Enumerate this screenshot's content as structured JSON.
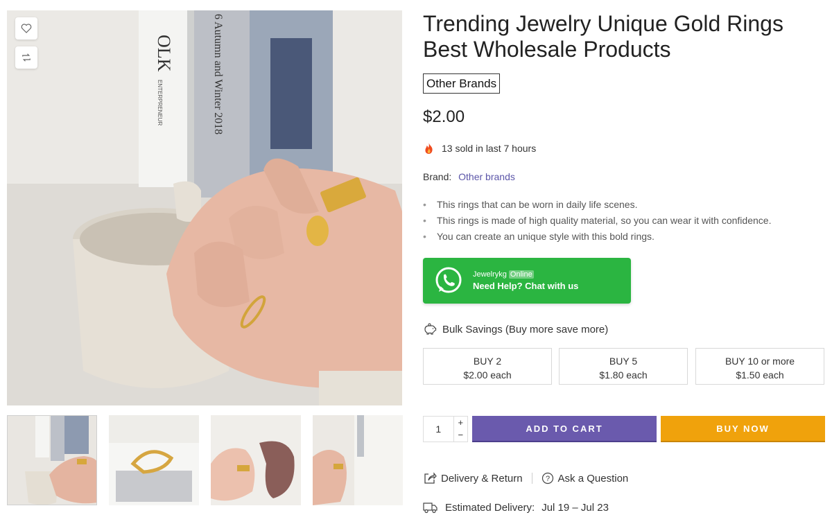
{
  "product": {
    "title": "Trending Jewelry Unique Gold Rings Best Wholesale Products",
    "brand_tag": "Other Brands",
    "price": "$2.00",
    "sold_text": "13 sold in last 7 hours",
    "brand_label": "Brand:",
    "brand_value": "Other brands",
    "features": [
      "This rings that can be worn in daily life scenes.",
      "This rings is made of high quality material, so you can wear it with confidence.",
      "You can create an unique style with this bold rings."
    ]
  },
  "chat": {
    "name": "Jewelrykg",
    "status": "Online",
    "cta": "Need Help? Chat with us"
  },
  "bulk": {
    "heading": "Bulk Savings (Buy more save more)",
    "tiers": [
      {
        "qty": "BUY 2",
        "price": "$2.00 each"
      },
      {
        "qty": "BUY 5",
        "price": "$1.80 each"
      },
      {
        "qty": "BUY 10 or more",
        "price": "$1.50 each"
      }
    ]
  },
  "cart": {
    "quantity": "1",
    "plus": "+",
    "minus": "−",
    "add_to_cart": "ADD TO CART",
    "buy_now": "BUY NOW"
  },
  "links": {
    "delivery_return": "Delivery & Return",
    "ask_question": "Ask a Question"
  },
  "delivery": {
    "label": "Estimated Delivery:",
    "range": "Jul 19 – Jul 23"
  },
  "photo": {
    "book_spine_1": "OLK",
    "book_spine_2": "6 Autumn and Winter 2018",
    "book_subtitle": "ENTERPRENEUR"
  },
  "colors": {
    "accent_purple": "#6a5aad",
    "buy_orange": "#f0a20c",
    "whatsapp_green": "#2bb541",
    "link_purple": "#5b55a8"
  },
  "icons": [
    "heart-icon",
    "compare-icon",
    "fire-icon",
    "whatsapp-icon",
    "piggy-bank-icon",
    "share-icon",
    "question-icon",
    "truck-icon"
  ]
}
